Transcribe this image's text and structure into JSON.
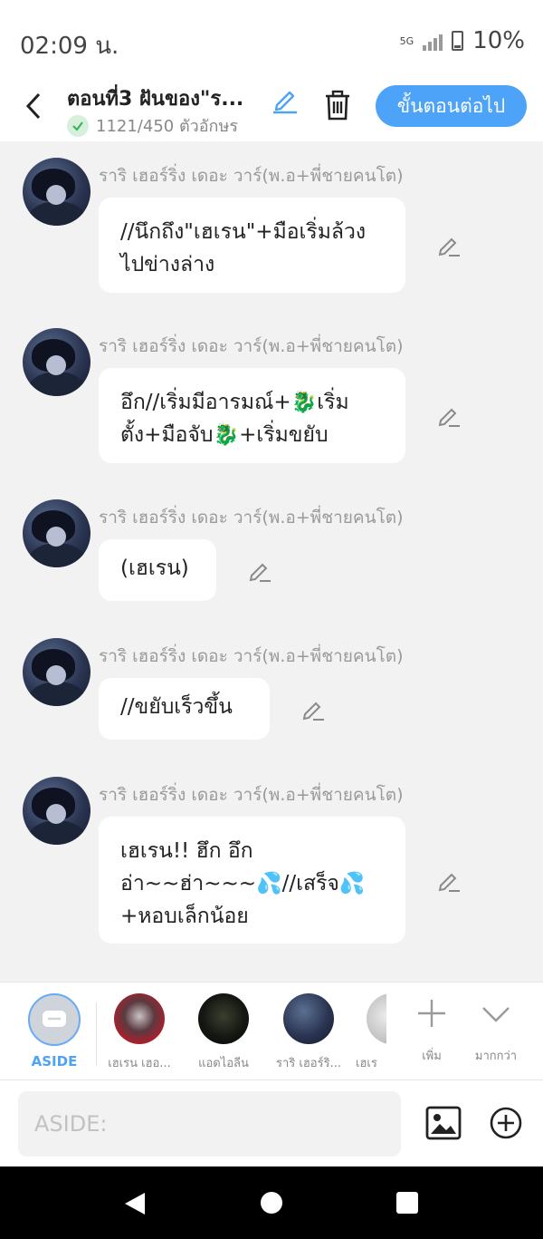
{
  "status_bar": {
    "time": "02:09 น.",
    "network": "5G",
    "battery": "10%"
  },
  "header": {
    "title": "ตอนที่3 ฝันของ\"ร...",
    "char_count": "1121/450 ตัวอักษร",
    "next_button": "ขั้นตอนต่อไป"
  },
  "messages": [
    {
      "sender": "ราริ เฮอร์ริ่ง เดอะ วาร์(พ.อ+พี่ชายคนโต)",
      "lines": [
        "//นึกถึง\"เฮเรน\"+มือเริ่มล้วง",
        "ไปข่างล่าง"
      ]
    },
    {
      "sender": "ราริ เฮอร์ริ่ง เดอะ วาร์(พ.อ+พี่ชายคนโต)",
      "lines": [
        "อึก//เริ่มมีอารมณ์+🐉เริ่ม",
        "ตั้ง+มือจับ🐉+เริ่มขยับ"
      ]
    },
    {
      "sender": "ราริ เฮอร์ริ่ง เดอะ วาร์(พ.อ+พี่ชายคนโต)",
      "lines": [
        "(เฮเรน)"
      ]
    },
    {
      "sender": "ราริ เฮอร์ริ่ง เดอะ วาร์(พ.อ+พี่ชายคนโต)",
      "lines": [
        "//ขยับเร็วขึ้น"
      ]
    },
    {
      "sender": "ราริ เฮอร์ริ่ง เดอะ วาร์(พ.อ+พี่ชายคนโต)",
      "lines": [
        "เฮเรน!! ฮึก อึก",
        "อ่า~~ฮ่า~~~💦//เสร็จ💦",
        "+หอบเล็กน้อย"
      ]
    }
  ],
  "characters": {
    "aside_label": "ASIDE",
    "items": [
      "เฮเรน เฮอ...",
      "แอดไอลีน",
      "ราริ เฮอร์ริ...",
      "เฮเร"
    ],
    "add_label": "เพิ่ม",
    "more_label": "มากกว่า"
  },
  "input": {
    "placeholder": "ASIDE:"
  },
  "colors": {
    "accent": "#4da3f7",
    "background": "#f2f2f2",
    "bubble": "#ffffff"
  }
}
